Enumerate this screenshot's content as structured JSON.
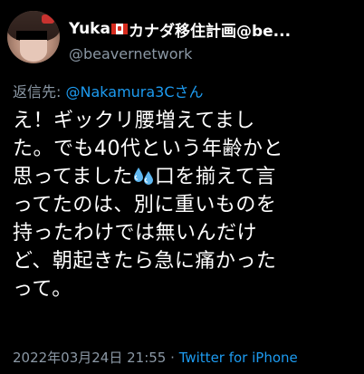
{
  "user": {
    "display_name": "Yuka",
    "display_name_suffix": "カナダ移住計画@be...",
    "flag_icon": "canada-flag-icon",
    "handle": "@beavernetwork"
  },
  "reply": {
    "prefix": "返信先:",
    "mention": "@Nakamura3Cさん"
  },
  "tweet": {
    "line1": "え！ギックリ腰増えてまし",
    "line2": "た。でも40代という年齢かと",
    "line3a": "思ってました",
    "line3_icon": "sweat-droplets-icon",
    "line3b": "口を揃えて言",
    "line4": "ってたのは、別に重いものを",
    "line5": "持ったわけでは無いんだけ",
    "line6": "ど、朝起きたら急に痛かった",
    "line7": "って。"
  },
  "meta": {
    "timestamp": "2022年03月24日 21:55",
    "separator": "·",
    "source": "Twitter for iPhone"
  },
  "colors": {
    "background": "#000000",
    "text": "#ffffff",
    "secondary": "#8b98a5",
    "link": "#1d9bf0"
  }
}
